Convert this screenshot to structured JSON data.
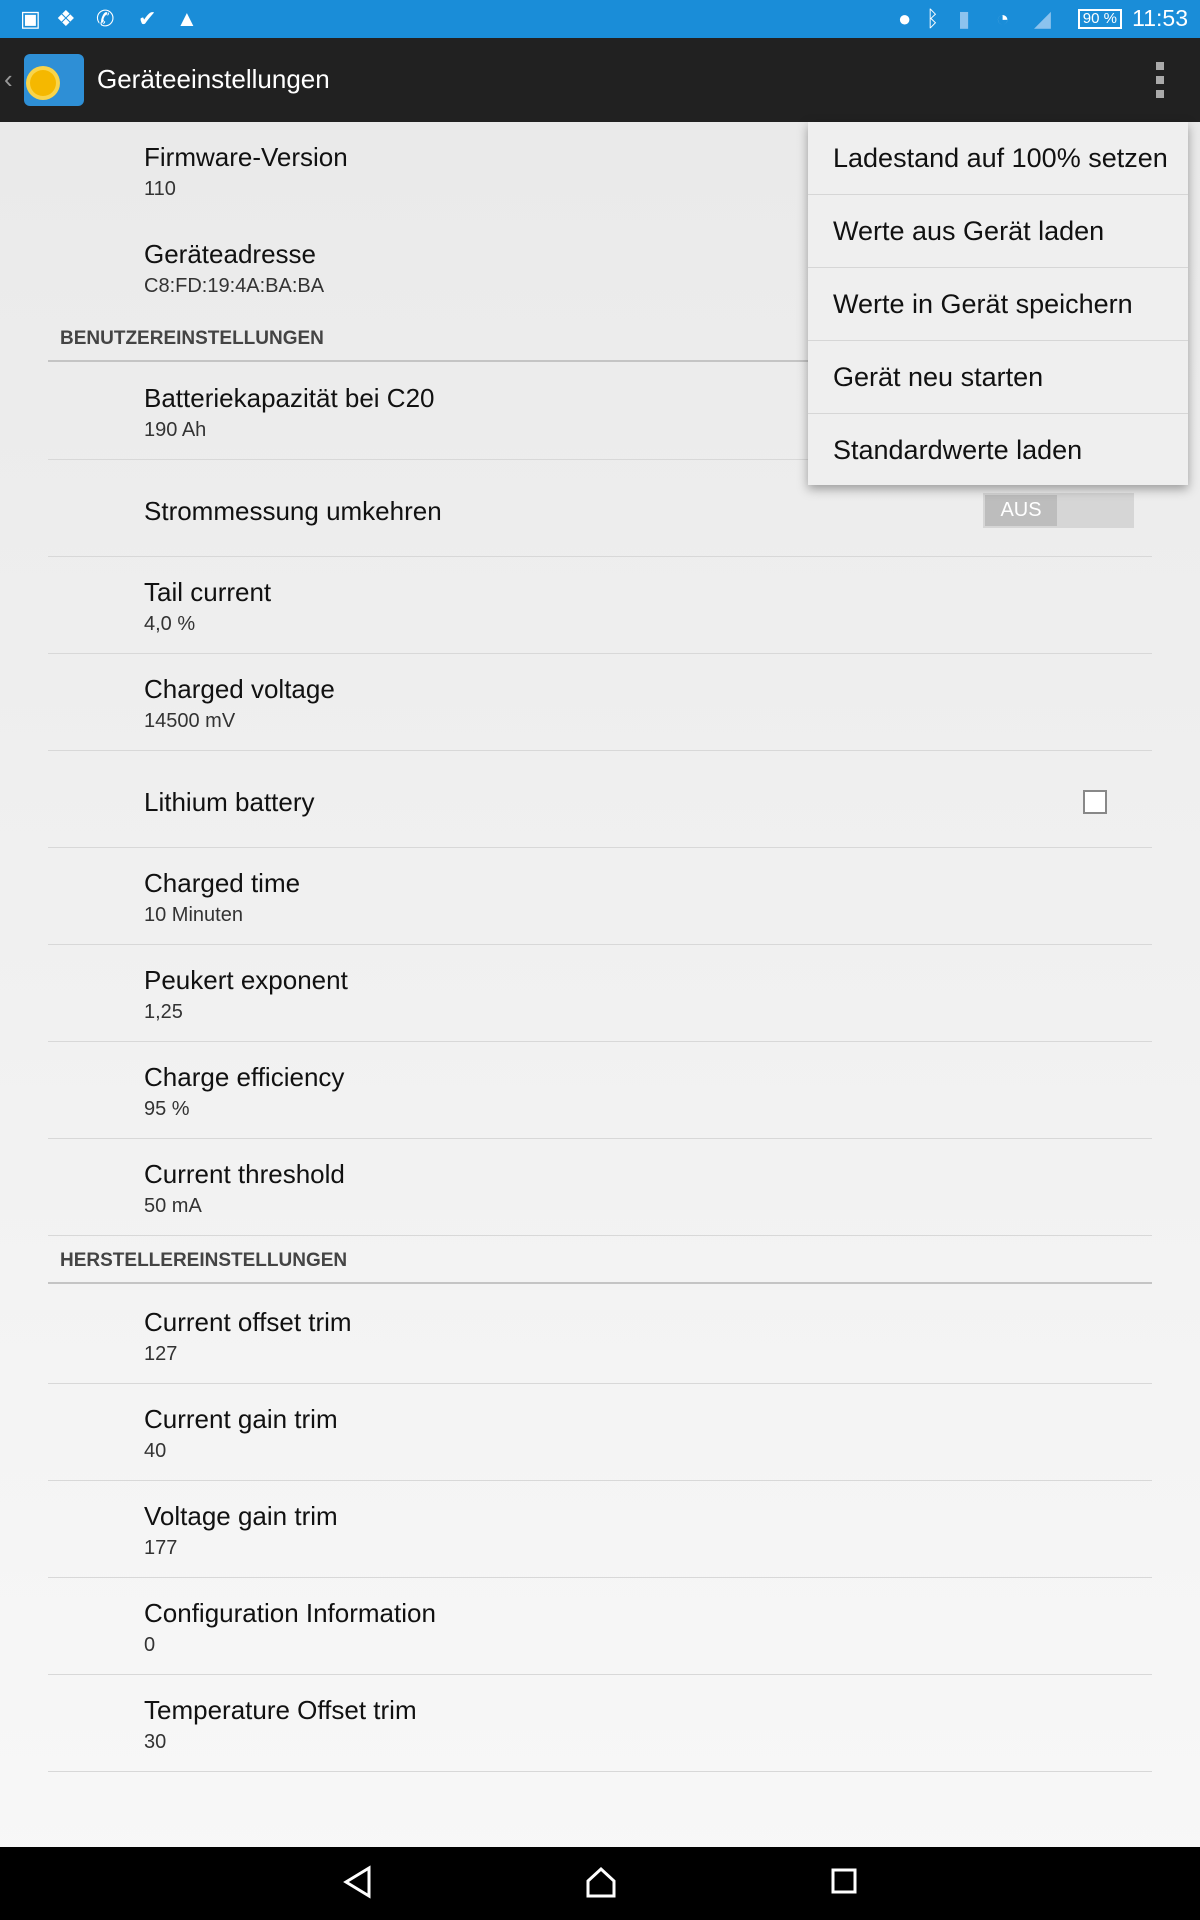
{
  "status_bar": {
    "time": "11:53",
    "battery": "90 %",
    "icons": [
      "image-icon",
      "dropbox-icon",
      "phone-icon",
      "checkmark-flag-icon",
      "warning-icon",
      "location-icon",
      "bluetooth-icon",
      "sim-icon",
      "wifi-icon",
      "signal-icon"
    ]
  },
  "action_bar": {
    "title": "Geräteeinstellungen"
  },
  "info": [
    {
      "title": "Firmware-Version",
      "value": "110"
    },
    {
      "title": "Geräteadresse",
      "value": "C8:FD:19:4A:BA:BA"
    }
  ],
  "user_section": {
    "header": "BENUTZEREINSTELLUNGEN",
    "items": [
      {
        "title": "Batteriekapazität bei C20",
        "value": "190 Ah"
      },
      {
        "title": "Strommessung umkehren",
        "toggle": "AUS"
      },
      {
        "title": "Tail current",
        "value": "4,0 %"
      },
      {
        "title": "Charged voltage",
        "value": "14500 mV"
      },
      {
        "title": "Lithium battery",
        "checked": false
      },
      {
        "title": "Charged time",
        "value": "10 Minuten"
      },
      {
        "title": "Peukert exponent",
        "value": "1,25"
      },
      {
        "title": "Charge efficiency",
        "value": "95 %"
      },
      {
        "title": "Current threshold",
        "value": "50 mA"
      }
    ]
  },
  "maker_section": {
    "header": "HERSTELLEREINSTELLUNGEN",
    "items": [
      {
        "title": "Current offset trim",
        "value": "127"
      },
      {
        "title": "Current gain trim",
        "value": "40"
      },
      {
        "title": "Voltage gain trim",
        "value": "177"
      },
      {
        "title": "Configuration Information",
        "value": "0"
      },
      {
        "title": "Temperature Offset trim",
        "value": "30"
      }
    ]
  },
  "menu": [
    "Ladestand auf 100% setzen",
    "Werte aus Gerät laden",
    "Werte in Gerät speichern",
    "Gerät neu starten",
    "Standardwerte laden"
  ],
  "colors": {
    "status_bar": "#1a8dd8",
    "action_bar": "#212121"
  }
}
